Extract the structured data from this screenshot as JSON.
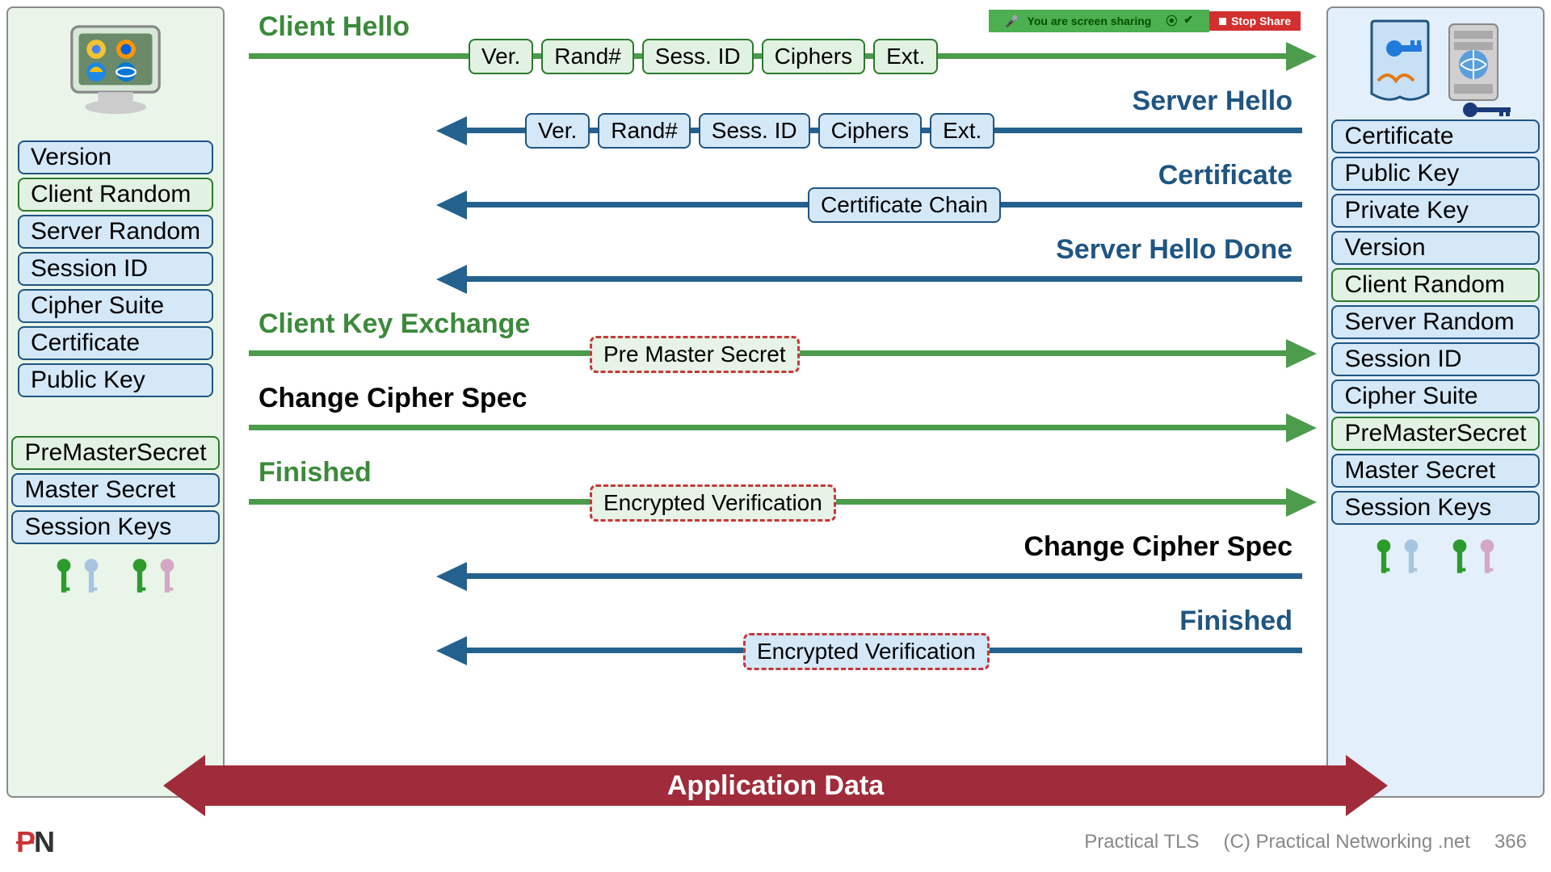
{
  "share_bar": {
    "text": "You are screen sharing",
    "stop": "Stop Share"
  },
  "client": {
    "tags1": [
      {
        "text": "Version",
        "cls": "tag-blue"
      },
      {
        "text": "Client Random",
        "cls": "tag-green"
      },
      {
        "text": "Server Random",
        "cls": "tag-blue"
      },
      {
        "text": "Session ID",
        "cls": "tag-blue"
      },
      {
        "text": "Cipher Suite",
        "cls": "tag-blue"
      },
      {
        "text": "Certificate",
        "cls": "tag-blue"
      },
      {
        "text": "Public Key",
        "cls": "tag-blue"
      }
    ],
    "tags2": [
      {
        "text": "PreMasterSecret",
        "cls": "tag-green"
      },
      {
        "text": "Master Secret",
        "cls": "tag-blue"
      },
      {
        "text": "Session Keys",
        "cls": "tag-blue"
      }
    ]
  },
  "server": {
    "tags1": [
      {
        "text": "Certificate",
        "cls": "tag-blue"
      },
      {
        "text": "Public Key",
        "cls": "tag-blue"
      },
      {
        "text": "Private Key",
        "cls": "tag-blue"
      },
      {
        "text": "Version",
        "cls": "tag-blue"
      },
      {
        "text": "Client Random",
        "cls": "tag-green"
      },
      {
        "text": "Server Random",
        "cls": "tag-blue"
      },
      {
        "text": "Session ID",
        "cls": "tag-blue"
      },
      {
        "text": "Cipher Suite",
        "cls": "tag-blue"
      },
      {
        "text": "PreMasterSecret",
        "cls": "tag-green"
      },
      {
        "text": "Master Secret",
        "cls": "tag-blue"
      },
      {
        "text": "Session Keys",
        "cls": "tag-blue"
      }
    ]
  },
  "flows": [
    {
      "label": "Client Hello",
      "side": "left",
      "color": "green",
      "dir": "right",
      "packets": [
        "Ver.",
        "Rand#",
        "Sess. ID",
        "Ciphers",
        "Ext."
      ],
      "pcls": "green",
      "pleft": 280
    },
    {
      "label": "Server Hello",
      "side": "right",
      "color": "blue",
      "dir": "left",
      "packets": [
        "Ver.",
        "Rand#",
        "Sess. ID",
        "Ciphers",
        "Ext."
      ],
      "pcls": "blue",
      "pleft": 350
    },
    {
      "label": "Certificate",
      "side": "right",
      "color": "blue",
      "dir": "left",
      "packets": [
        "Certificate Chain"
      ],
      "pcls": "blue",
      "pleft": 700
    },
    {
      "label": "Server Hello Done",
      "side": "right",
      "color": "blue",
      "dir": "left",
      "packets": [],
      "pcls": "blue",
      "pleft": 0
    },
    {
      "label": "Client Key Exchange",
      "side": "left",
      "color": "green",
      "dir": "right",
      "packets": [
        "Pre Master Secret"
      ],
      "pcls": "dashed-green",
      "pleft": 430
    },
    {
      "label": "Change Cipher Spec",
      "side": "left",
      "color": "black",
      "dir": "right",
      "linecolor": "green",
      "packets": [],
      "pcls": "green",
      "pleft": 0
    },
    {
      "label": "Finished",
      "side": "left",
      "color": "green",
      "dir": "right",
      "packets": [
        "Encrypted Verification"
      ],
      "pcls": "dashed-green",
      "pleft": 430
    },
    {
      "label": "Change Cipher Spec",
      "side": "right",
      "color": "black",
      "dir": "left",
      "linecolor": "blue",
      "packets": [],
      "pcls": "blue",
      "pleft": 0
    },
    {
      "label": "Finished",
      "side": "right",
      "color": "blue",
      "dir": "left",
      "packets": [
        "Encrypted Verification"
      ],
      "pcls": "dashed-blue",
      "pleft": 620
    }
  ],
  "app_data": "Application Data",
  "footer": {
    "title": "Practical TLS",
    "copyright": "(C) Practical Networking .net",
    "page": "366"
  }
}
